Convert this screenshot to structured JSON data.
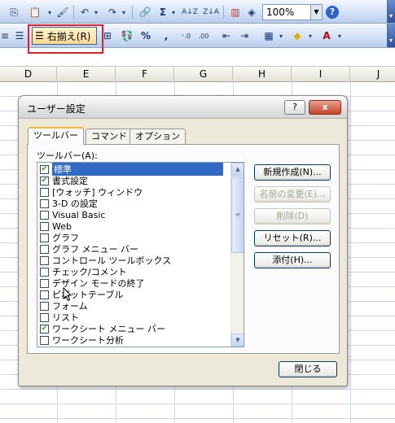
{
  "toolbar1": {
    "zoom_value": "100%",
    "sum_label": "Σ",
    "sort_asc_label": "A↓Z",
    "sort_desc_label": "Z↓A",
    "help_label": "?"
  },
  "toolbar2": {
    "align_right_label": "右揃え(R)",
    "percent_label": "%",
    "comma_label": ","
  },
  "columns": [
    "D",
    "E",
    "F",
    "G",
    "H",
    "I",
    "J"
  ],
  "dialog": {
    "title": "ユーザー設定",
    "help_button": "?",
    "close_button": "x",
    "tabs": [
      {
        "label": "ツールバー"
      },
      {
        "label": "コマンド"
      },
      {
        "label": "オプション"
      }
    ],
    "list_label": "ツールバー(A):",
    "toolbars": [
      {
        "label": "標準",
        "checked": true,
        "selected": true
      },
      {
        "label": "書式設定",
        "checked": true
      },
      {
        "label": "[ウォッチ] ウィンドウ",
        "checked": false
      },
      {
        "label": "3-D の設定",
        "checked": false
      },
      {
        "label": "Visual Basic",
        "checked": false
      },
      {
        "label": "Web",
        "checked": false
      },
      {
        "label": "グラフ",
        "checked": false
      },
      {
        "label": "グラフ メニュー バー",
        "checked": false
      },
      {
        "label": "コントロール ツールボックス",
        "checked": false
      },
      {
        "label": "チェック/コメント",
        "checked": false
      },
      {
        "label": "デザイン モードの終了",
        "checked": false
      },
      {
        "label": "ピボットテーブル",
        "checked": false
      },
      {
        "label": "フォーム",
        "checked": false
      },
      {
        "label": "リスト",
        "checked": false
      },
      {
        "label": "ワークシート メニュー バー",
        "checked": true
      },
      {
        "label": "ワークシート分析",
        "checked": false
      }
    ],
    "buttons": {
      "new": "新規作成(N)...",
      "rename": "名前の変更(E)...",
      "delete": "削除(D)",
      "reset": "リセット(R)...",
      "attach": "添付(H)...",
      "close": "閉じる"
    }
  }
}
